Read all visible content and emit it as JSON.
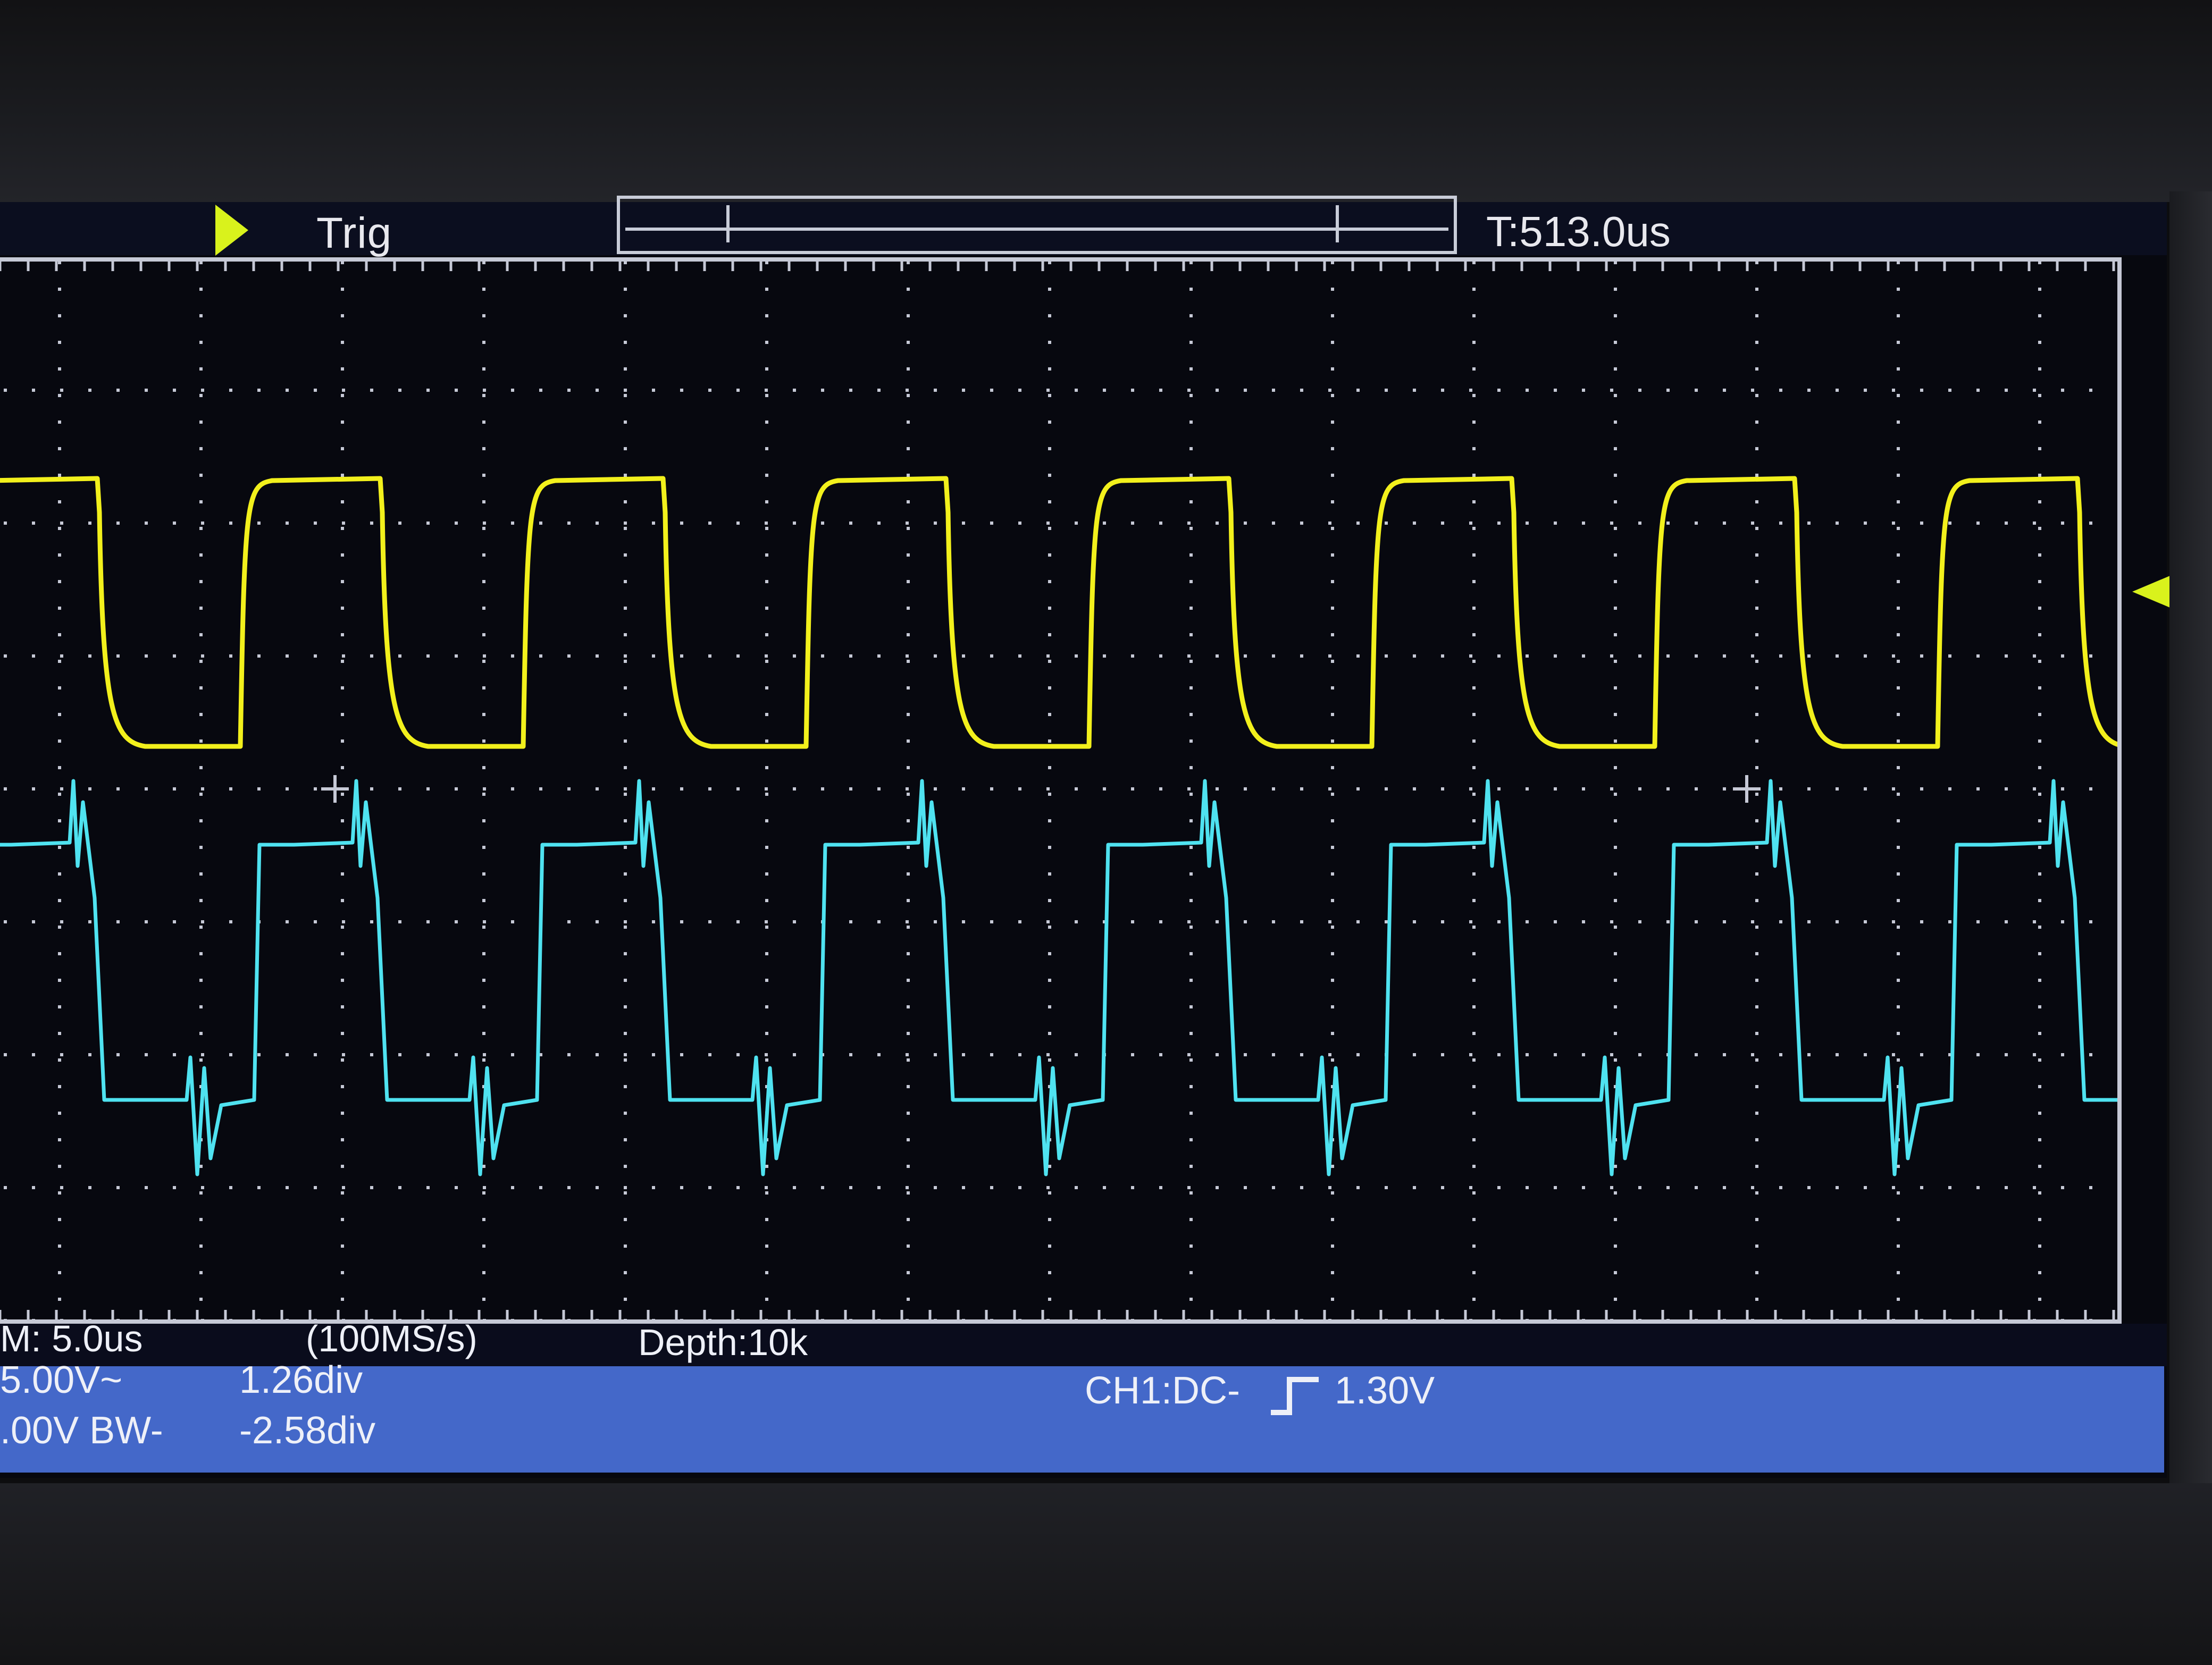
{
  "header": {
    "trigger_status": "Trig",
    "trigger_time": "T:513.0us"
  },
  "footer": {
    "timebase": "M: 5.0us",
    "sample_rate": "(100MS/s)",
    "memory_depth": "Depth:10k",
    "ch1_scale": "5.00V~",
    "ch1_position": "1.26div",
    "ch2_scale": ".00V BW-",
    "ch2_position": "-2.58div",
    "trigger_setting": "CH1:DC-",
    "trigger_level": "1.30V"
  },
  "colors": {
    "ch1_trace": "#f2f01c",
    "ch2_trace": "#4fe2f0",
    "grid_dots": "#c6c9d6",
    "status_band": "#4468c9",
    "screen_background": "#07080f"
  },
  "icons": {
    "trigger_marker": "yellow-right-triangle",
    "ch1_level_marker": "yellow-left-triangle",
    "trigger_edge": "rising-edge-icon"
  }
}
